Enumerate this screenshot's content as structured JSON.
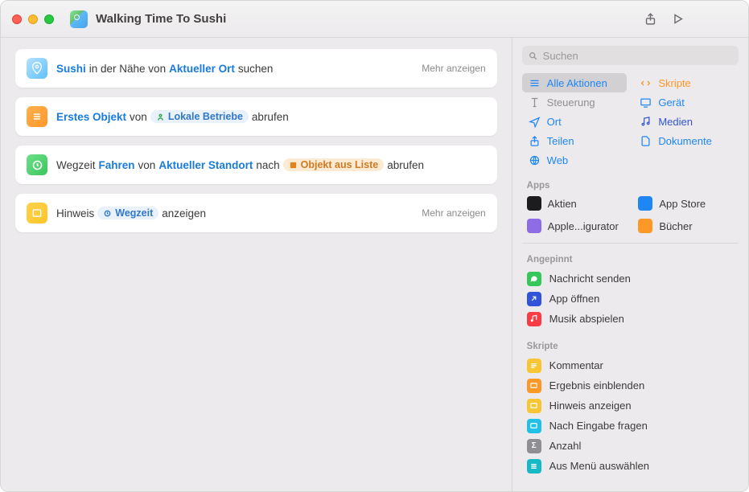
{
  "title": "Walking Time To Sushi",
  "labels": {
    "more": "Mehr anzeigen"
  },
  "actions": [
    {
      "query": "Sushi",
      "t1": "in der Nähe von",
      "location": "Aktueller Ort",
      "t2": "suchen"
    },
    {
      "item": "Erstes Objekt",
      "t1": "von",
      "source": "Lokale Betriebe",
      "t2": "abrufen"
    },
    {
      "t0": "Wegzeit",
      "mode": "Fahren",
      "t1": "von",
      "origin": "Aktueller Standort",
      "t2": "nach",
      "dest": "Objekt aus Liste",
      "t3": "abrufen"
    },
    {
      "t0": "Hinweis",
      "msg": "Wegzeit",
      "t1": "anzeigen"
    }
  ],
  "sidebar": {
    "search_placeholder": "Suchen",
    "categories": [
      "Alle Aktionen",
      "Skripte",
      "Steuerung",
      "Gerät",
      "Ort",
      "Medien",
      "Teilen",
      "Dokumente",
      "Web"
    ],
    "apps_header": "Apps",
    "apps": [
      "Aktien",
      "App Store",
      "Apple...igurator",
      "Bücher"
    ],
    "pinned_header": "Angepinnt",
    "pinned": [
      "Nachricht senden",
      "App öffnen",
      "Musik abspielen"
    ],
    "scripts_header": "Skripte",
    "scripts": [
      "Kommentar",
      "Ergebnis einblenden",
      "Hinweis anzeigen",
      "Nach Eingabe fragen",
      "Anzahl",
      "Aus Menü auswählen"
    ]
  }
}
